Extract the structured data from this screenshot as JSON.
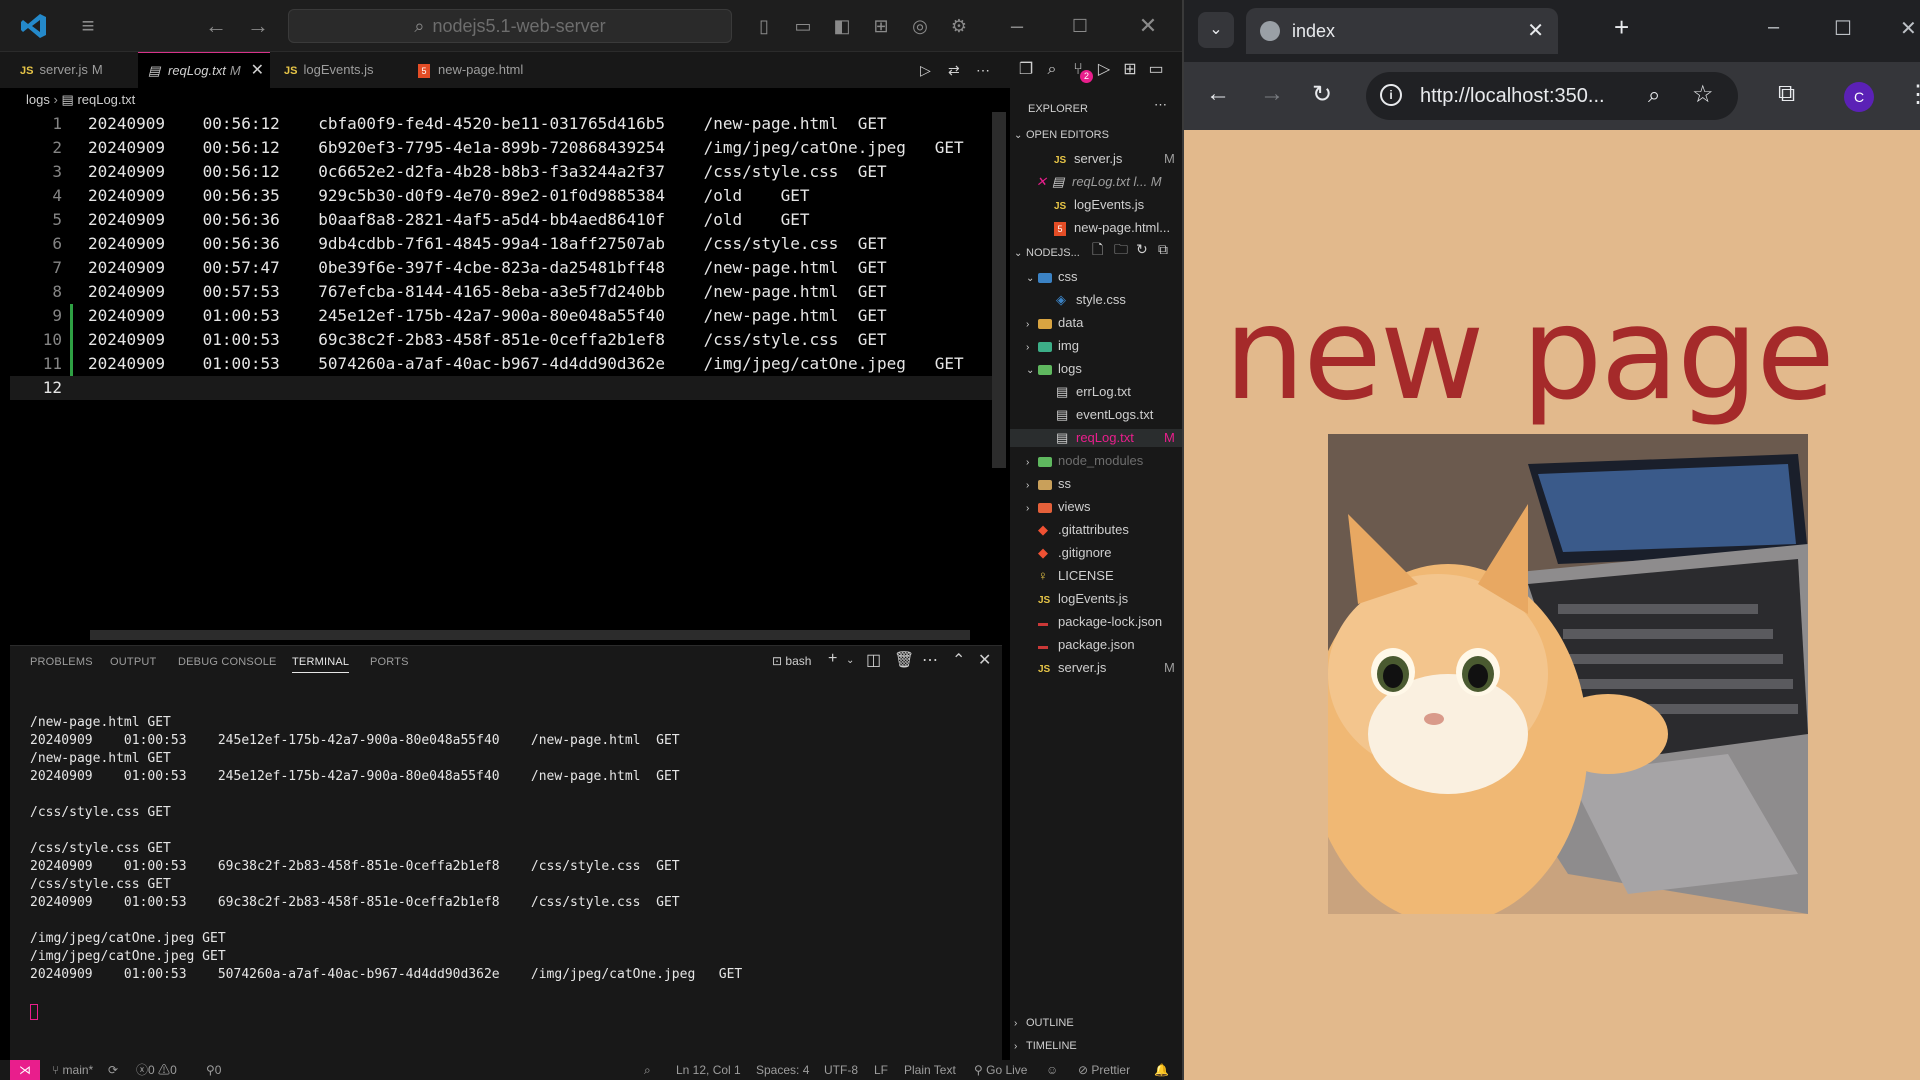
{
  "vscode": {
    "search_text": "nodejs5.1-web-server",
    "tabs": [
      {
        "label": "server.js",
        "status": "M"
      },
      {
        "label": "reqLog.txt",
        "status": "M"
      },
      {
        "label": "logEvents.js",
        "status": ""
      },
      {
        "label": "new-page.html",
        "status": ""
      }
    ],
    "breadcrumb": {
      "folder": "logs",
      "file": "reqLog.txt"
    },
    "editor_lines": [
      {
        "n": "1",
        "text": "20240909\t00:56:12\tcbfa00f9-fe4d-4520-be11-031765d416b5\t/new-page.html\tGET"
      },
      {
        "n": "2",
        "text": "20240909\t00:56:12\t6b920ef3-7795-4e1a-899b-720868439254\t/img/jpeg/catOne.jpeg\tGET"
      },
      {
        "n": "3",
        "text": "20240909\t00:56:12\t0c6652e2-d2fa-4b28-b8b3-f3a3244a2f37\t/css/style.css\tGET"
      },
      {
        "n": "4",
        "text": "20240909\t00:56:35\t929c5b30-d0f9-4e70-89e2-01f0d9885384\t/old\tGET"
      },
      {
        "n": "5",
        "text": "20240909\t00:56:36\tb0aaf8a8-2821-4af5-a5d4-bb4aed86410f\t/old\tGET"
      },
      {
        "n": "6",
        "text": "20240909\t00:56:36\t9db4cdbb-7f61-4845-99a4-18aff27507ab\t/css/style.css\tGET"
      },
      {
        "n": "7",
        "text": "20240909\t00:57:47\t0be39f6e-397f-4cbe-823a-da25481bff48\t/new-page.html\tGET"
      },
      {
        "n": "8",
        "text": "20240909\t00:57:53\t767efcba-8144-4165-8eba-a3e5f7d240bb\t/new-page.html\tGET"
      },
      {
        "n": "9",
        "text": "20240909\t01:00:53\t245e12ef-175b-42a7-900a-80e048a55f40\t/new-page.html\tGET"
      },
      {
        "n": "10",
        "text": "20240909\t01:00:53\t69c38c2f-2b83-458f-851e-0ceffa2b1ef8\t/css/style.css\tGET"
      },
      {
        "n": "11",
        "text": "20240909\t01:00:53\t5074260a-a7af-40ac-b967-4d4dd90d362e\t/img/jpeg/catOne.jpeg\tGET"
      },
      {
        "n": "12",
        "text": ""
      }
    ],
    "panel_tabs": [
      "PROBLEMS",
      "OUTPUT",
      "DEBUG CONSOLE",
      "TERMINAL",
      "PORTS"
    ],
    "terminal_shell": "bash",
    "terminal_lines": [
      "/new-page.html GET",
      "20240909\t01:00:53\t245e12ef-175b-42a7-900a-80e048a55f40\t/new-page.html\tGET",
      "/new-page.html GET",
      "20240909\t01:00:53\t245e12ef-175b-42a7-900a-80e048a55f40\t/new-page.html\tGET",
      "",
      "/css/style.css GET",
      "",
      "/css/style.css GET",
      "20240909\t01:00:53\t69c38c2f-2b83-458f-851e-0ceffa2b1ef8\t/css/style.css\tGET",
      "/css/style.css GET",
      "20240909\t01:00:53\t69c38c2f-2b83-458f-851e-0ceffa2b1ef8\t/css/style.css\tGET",
      "",
      "/img/jpeg/catOne.jpeg GET",
      "/img/jpeg/catOne.jpeg GET",
      "20240909\t01:00:53\t5074260a-a7af-40ac-b967-4d4dd90d362e\t/img/jpeg/catOne.jpeg\tGET"
    ],
    "explorer": {
      "title": "EXPLORER",
      "open_editors_label": "OPEN EDITORS",
      "open_editors": [
        {
          "label": "server.js",
          "status": "M"
        },
        {
          "label": "reqLog.txt",
          "status": "l... M"
        },
        {
          "label": "logEvents.js",
          "status": ""
        },
        {
          "label": "new-page.html...",
          "status": ""
        }
      ],
      "project_label": "NODEJS...",
      "tree": [
        {
          "label": "css",
          "status": ""
        },
        {
          "label": "style.css",
          "status": ""
        },
        {
          "label": "data",
          "status": ""
        },
        {
          "label": "img",
          "status": ""
        },
        {
          "label": "logs",
          "status": ""
        },
        {
          "label": "errLog.txt",
          "status": ""
        },
        {
          "label": "eventLogs.txt",
          "status": ""
        },
        {
          "label": "reqLog.txt",
          "status": "M"
        },
        {
          "label": "node_modules",
          "status": ""
        },
        {
          "label": "ss",
          "status": ""
        },
        {
          "label": "views",
          "status": ""
        },
        {
          "label": ".gitattributes",
          "status": ""
        },
        {
          "label": ".gitignore",
          "status": ""
        },
        {
          "label": "LICENSE",
          "status": ""
        },
        {
          "label": "logEvents.js",
          "status": ""
        },
        {
          "label": "package-lock.json",
          "status": ""
        },
        {
          "label": "package.json",
          "status": ""
        },
        {
          "label": "server.js",
          "status": "M"
        }
      ],
      "outline_label": "OUTLINE",
      "timeline_label": "TIMELINE",
      "badge_count": "2"
    },
    "statusbar": {
      "branch": "main*",
      "errors": "0",
      "warnings": "0",
      "ports": "0",
      "position": "Ln 12, Col 1",
      "spaces": "Spaces: 4",
      "encoding": "UTF-8",
      "eol": "LF",
      "language": "Plain Text",
      "golive": "Go Live",
      "prettier": "Prettier"
    },
    "colors": {
      "accent": "#e91e8c",
      "background": "#000000"
    }
  },
  "browser": {
    "tab_title": "index",
    "url": "http://localhost:350...",
    "avatar_letter": "C",
    "page_heading": "new page",
    "image_alt": "orange cat sitting at a laptop",
    "colors": {
      "page_bg": "#e2b98c",
      "heading": "#a52a2a"
    }
  }
}
